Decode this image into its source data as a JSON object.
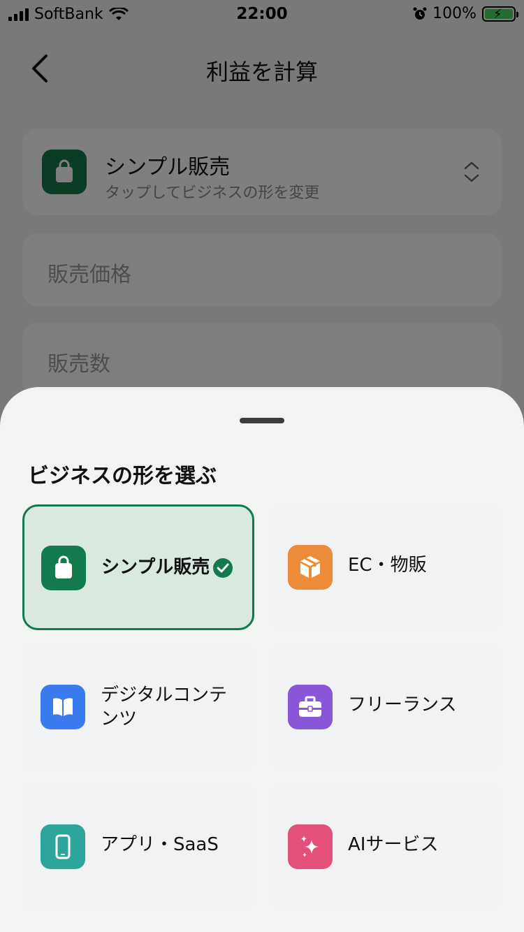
{
  "status": {
    "carrier": "SoftBank",
    "time": "22:00",
    "battery": "100%"
  },
  "nav": {
    "title": "利益を計算"
  },
  "type_card": {
    "title": "シンプル販売",
    "subtitle": "タップしてビジネスの形を変更"
  },
  "fields": [
    {
      "placeholder": "販売価格"
    },
    {
      "placeholder": "販売数"
    }
  ],
  "sheet": {
    "title": "ビジネスの形を選ぶ",
    "options": [
      {
        "label": "シンプル販売",
        "icon": "shopping-bag-icon",
        "color": "#127a4d",
        "selected": true
      },
      {
        "label": "EC・物販",
        "icon": "package-icon",
        "color": "#ed8b38",
        "selected": false
      },
      {
        "label": "デジタルコンテンツ",
        "icon": "book-icon",
        "color": "#3a7cf0",
        "selected": false
      },
      {
        "label": "フリーランス",
        "icon": "briefcase-icon",
        "color": "#8a56d8",
        "selected": false
      },
      {
        "label": "アプリ・SaaS",
        "icon": "smartphone-icon",
        "color": "#2ea59a",
        "selected": false
      },
      {
        "label": "AIサービス",
        "icon": "sparkles-icon",
        "color": "#e4507a",
        "selected": false
      }
    ]
  },
  "colors": {
    "accent": "#127a4d",
    "sheet_bg": "#f1f4f0"
  }
}
